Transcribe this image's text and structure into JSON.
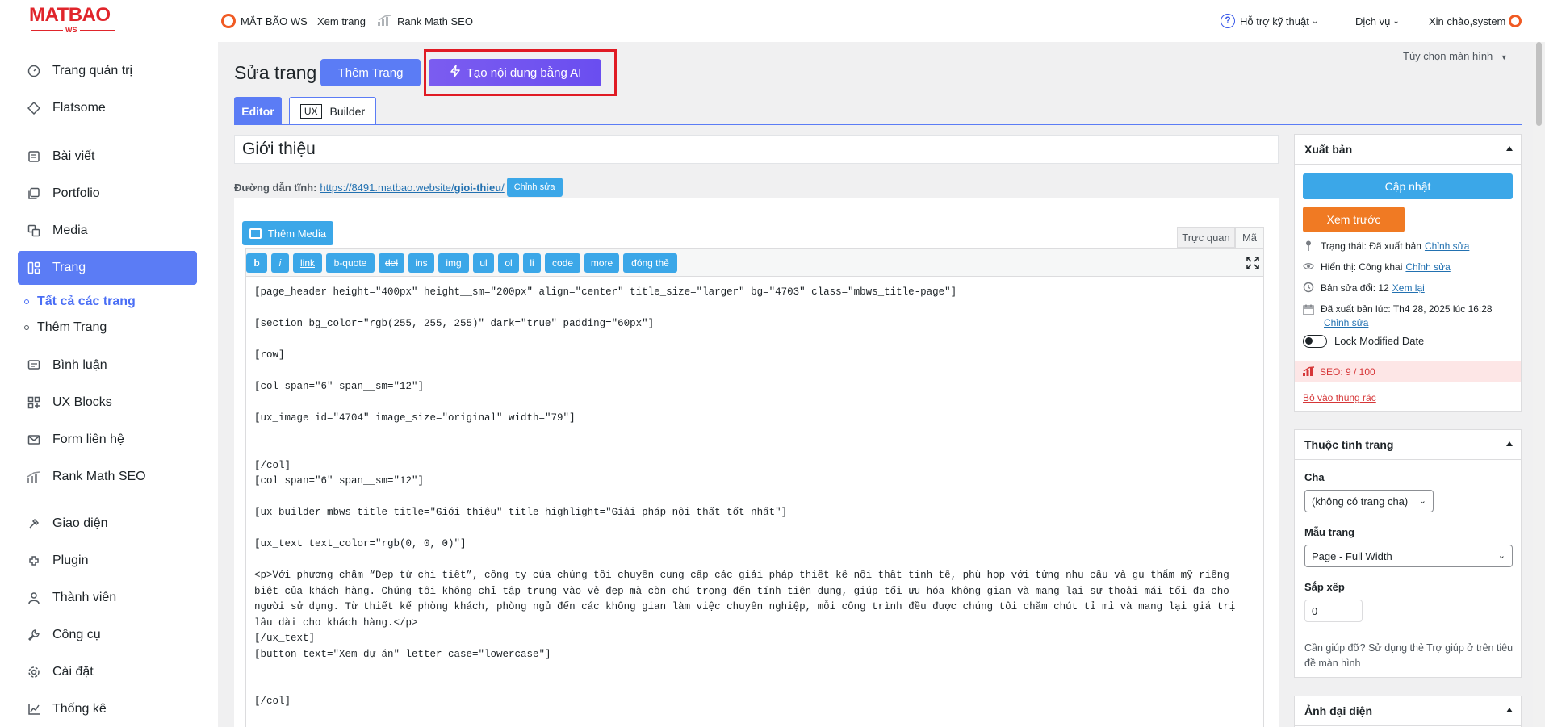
{
  "topbar": {
    "logo_text": "MATBAO",
    "logo_sub": "WS",
    "site_name": "MẮT BÃO WS",
    "view_page": "Xem trang",
    "rank_math": "Rank Math SEO",
    "support": "Hỗ trợ kỹ thuật",
    "services": "Dịch vụ",
    "greeting": "Xin chào,system"
  },
  "sidebar": {
    "items": [
      {
        "label": "Trang quản trị",
        "icon": "dashboard-icon"
      },
      {
        "label": "Flatsome",
        "icon": "diamond-icon"
      },
      {
        "label": "Bài viết",
        "icon": "posts-icon"
      },
      {
        "label": "Portfolio",
        "icon": "portfolio-icon"
      },
      {
        "label": "Media",
        "icon": "media-icon"
      },
      {
        "label": "Trang",
        "icon": "pages-icon"
      },
      {
        "label": "Bình luận",
        "icon": "comments-icon"
      },
      {
        "label": "UX Blocks",
        "icon": "blocks-icon"
      },
      {
        "label": "Form liên hệ",
        "icon": "mail-icon"
      },
      {
        "label": "Rank Math SEO",
        "icon": "chart-icon"
      },
      {
        "label": "Giao diện",
        "icon": "brush-icon"
      },
      {
        "label": "Plugin",
        "icon": "plugin-icon"
      },
      {
        "label": "Thành viên",
        "icon": "user-icon"
      },
      {
        "label": "Công cụ",
        "icon": "wrench-icon"
      },
      {
        "label": "Cài đặt",
        "icon": "settings-icon"
      },
      {
        "label": "Thống kê",
        "icon": "stats-icon"
      }
    ],
    "sub_items": [
      "Tất cả các trang",
      "Thêm Trang"
    ]
  },
  "header": {
    "screen_options": "Tùy chọn màn hình",
    "title": "Sửa trang",
    "add_page": "Thêm Trang",
    "ai_button": "Tạo nội dung bằng AI",
    "tab_editor": "Editor",
    "tab_ux": "UX",
    "tab_builder": "Builder"
  },
  "post": {
    "title": "Giới thiệu",
    "permalink_label": "Đường dẫn tĩnh:",
    "permalink_base": "https://8491.matbao.website/",
    "permalink_slug": "gioi-thieu",
    "permalink_trailing": "/",
    "permalink_edit": "Chỉnh sửa"
  },
  "editor": {
    "add_media": "Thêm Media",
    "mode_visual": "Trực quan",
    "mode_code": "Mã",
    "quicktags": [
      "b",
      "i",
      "link",
      "b-quote",
      "del",
      "ins",
      "img",
      "ul",
      "ol",
      "li",
      "code",
      "more",
      "đóng thẻ"
    ],
    "content": "[page_header height=\"400px\" height__sm=\"200px\" align=\"center\" title_size=\"larger\" bg=\"4703\" class=\"mbws_title-page\"]\n\n[section bg_color=\"rgb(255, 255, 255)\" dark=\"true\" padding=\"60px\"]\n\n[row]\n\n[col span=\"6\" span__sm=\"12\"]\n\n[ux_image id=\"4704\" image_size=\"original\" width=\"79\"]\n\n\n[/col]\n[col span=\"6\" span__sm=\"12\"]\n\n[ux_builder_mbws_title title=\"Giới thiệu\" title_highlight=\"Giải pháp nội thất tốt nhất\"]\n\n[ux_text text_color=\"rgb(0, 0, 0)\"]\n\n<p>Với phương châm “Đẹp từ chi tiết”, công ty của chúng tôi chuyên cung cấp các giải pháp thiết kế nội thất tinh tế, phù hợp với từng nhu cầu và gu thẩm mỹ riêng biệt của khách hàng. Chúng tôi không chỉ tập trung vào vẻ đẹp mà còn chú trọng đến tính tiện dụng, giúp tối ưu hóa không gian và mang lại sự thoải mái tối đa cho người sử dụng. Từ thiết kế phòng khách, phòng ngủ đến các không gian làm việc chuyên nghiệp, mỗi công trình đều được chúng tôi chăm chút tỉ mỉ và mang lại giá trị lâu dài cho khách hàng.</p>\n[/ux_text]\n[button text=\"Xem dự án\" letter_case=\"lowercase\"]\n\n\n[/col]\n\n[/row]"
  },
  "publish": {
    "title": "Xuất bản",
    "update": "Cập nhật",
    "preview": "Xem trước",
    "status": "Trạng thái: Đã xuất bản",
    "visibility": "Hiển thị: Công khai",
    "revisions": "Bản sửa đổi: 12",
    "view_revisions": "Xem lại",
    "published_on": "Đã xuất bản lúc: Th4 28, 2025 lúc 16:28",
    "edit_link": "Chỉnh sửa",
    "lock_modified": "Lock Modified Date",
    "seo_score": "SEO: 9 / 100",
    "trash": "Bỏ vào thùng rác"
  },
  "page_attributes": {
    "title": "Thuộc tính trang",
    "parent_label": "Cha",
    "parent_value": "(không có trang cha)",
    "template_label": "Mẫu trang",
    "template_value": "Page - Full Width",
    "order_label": "Sắp xếp",
    "order_value": "0",
    "help": "Cần giúp đỡ? Sử dụng thẻ Trợ giúp ở trên tiêu đề màn hình"
  },
  "featured_image": {
    "title": "Ảnh đại diện"
  }
}
